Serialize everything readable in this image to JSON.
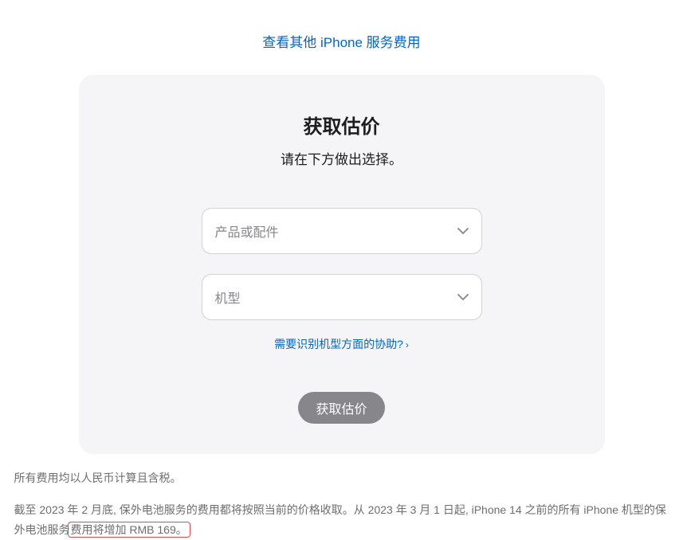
{
  "topLink": {
    "label": "查看其他 iPhone 服务费用"
  },
  "card": {
    "title": "获取估价",
    "subtitle": "请在下方做出选择。",
    "select1": {
      "placeholder": "产品或配件"
    },
    "select2": {
      "placeholder": "机型"
    },
    "helperLink": "需要识别机型方面的协助?",
    "submitLabel": "获取估价"
  },
  "footer": {
    "line1": "所有费用均以人民币计算且含税。",
    "line2_pre": "截至 2023 年 2 月底, 保外电池服务的费用都将按照当前的价格收取。从 2023 年 3 月 1 日起, iPhone 14 之前的所有 iPhone 机型的保外电池服务",
    "line2_highlight": "费用将增加 RMB 169。"
  }
}
